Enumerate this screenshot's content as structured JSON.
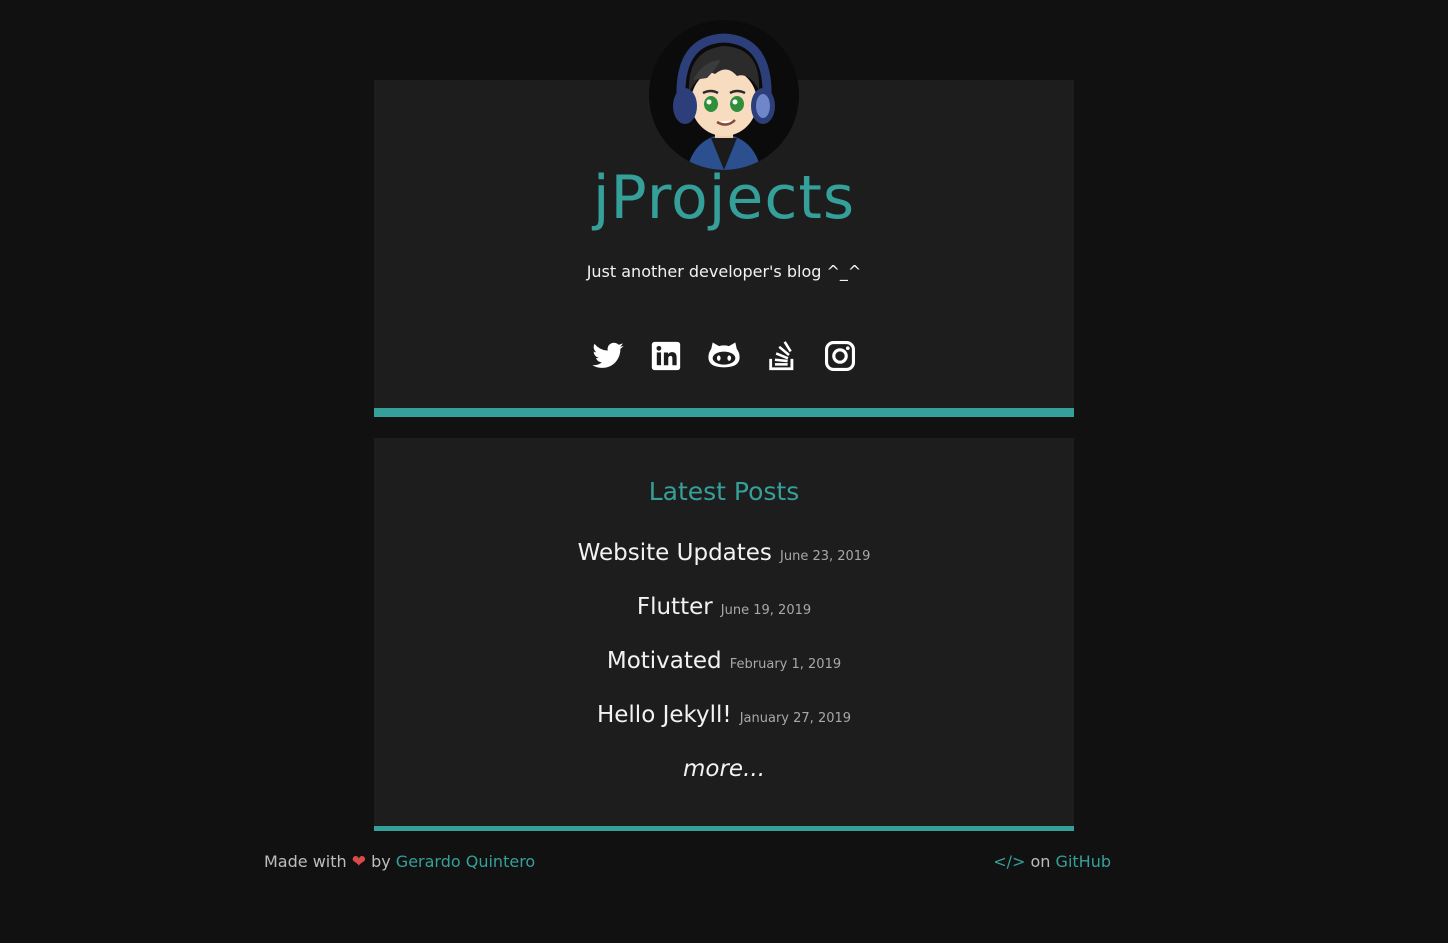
{
  "header": {
    "title": "jProjects",
    "tagline": "Just another developer's blog ^_^",
    "social": [
      {
        "icon": "twitter-icon",
        "label": "Twitter"
      },
      {
        "icon": "linkedin-icon",
        "label": "LinkedIn"
      },
      {
        "icon": "github-icon",
        "label": "GitHub"
      },
      {
        "icon": "stackoverflow-icon",
        "label": "Stack Overflow"
      },
      {
        "icon": "instagram-icon",
        "label": "Instagram"
      }
    ]
  },
  "posts": {
    "heading": "Latest Posts",
    "items": [
      {
        "title": "Website Updates",
        "date": "June 23, 2019"
      },
      {
        "title": "Flutter",
        "date": "June 19, 2019"
      },
      {
        "title": "Motivated",
        "date": "February 1, 2019"
      },
      {
        "title": "Hello Jekyll!",
        "date": "January 27, 2019"
      }
    ],
    "more": "more..."
  },
  "footer": {
    "made_with": "Made with",
    "heart": "❤",
    "by": "by",
    "author": "Gerardo Quintero",
    "code_glyph": "</>",
    "on": "on",
    "github": "GitHub"
  },
  "colors": {
    "accent": "#35a09a",
    "card": "#1d1d1d",
    "background": "#111111",
    "heart": "#d94a4a"
  }
}
